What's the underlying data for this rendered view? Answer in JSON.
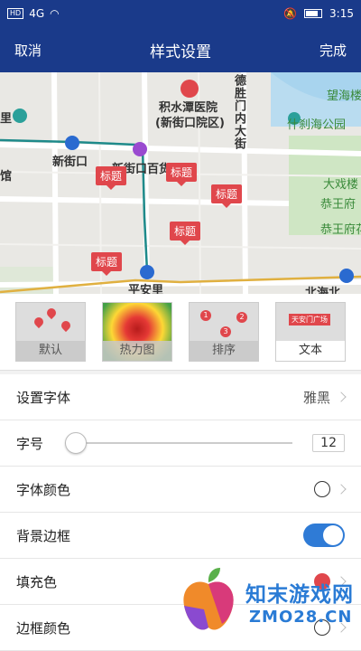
{
  "status_bar": {
    "network_badge": "HD",
    "signal": "4G",
    "time": "3:15"
  },
  "navbar": {
    "cancel": "取消",
    "title": "样式设置",
    "done": "完成"
  },
  "map": {
    "labels": {
      "hospital": "积水潭医院",
      "hospital_sub": "(新街口院区)",
      "xinjiekou": "新街口",
      "department": "新街口百货",
      "pinganli": "平安里",
      "beihai": "北海北",
      "deshengmen": "德胜门内大街",
      "shichahai": "什刹海公园",
      "wanghai": "望海楼",
      "daxilou": "大戏楼",
      "gongwangfu1": "恭王府",
      "gongwangfu2": "恭王府花",
      "guan": "馆",
      "li": "里"
    },
    "markers": [
      "标题",
      "标题",
      "标题",
      "标题",
      "标题"
    ]
  },
  "styles": [
    {
      "label": "默认"
    },
    {
      "label": "热力图"
    },
    {
      "label": "排序"
    },
    {
      "label": "文本",
      "sample": "天安门广场"
    }
  ],
  "settings": {
    "font": {
      "label": "设置字体",
      "value": "雅黑"
    },
    "font_size": {
      "label": "字号",
      "value": "12",
      "level": 0
    },
    "font_color": {
      "label": "字体颜色",
      "color": "#ffffff"
    },
    "border": {
      "label": "背景边框",
      "on": true
    },
    "fill_color": {
      "label": "填充色",
      "color": "#e0474c"
    },
    "border_color": {
      "label": "边框颜色",
      "color": "#ffffff"
    }
  },
  "watermark": {
    "name": "知末游戏网",
    "url": "ZMO28.CN"
  },
  "colors": {
    "primary": "#1a3a8a",
    "accent": "#2f7bd6",
    "marker": "#e0474c"
  }
}
